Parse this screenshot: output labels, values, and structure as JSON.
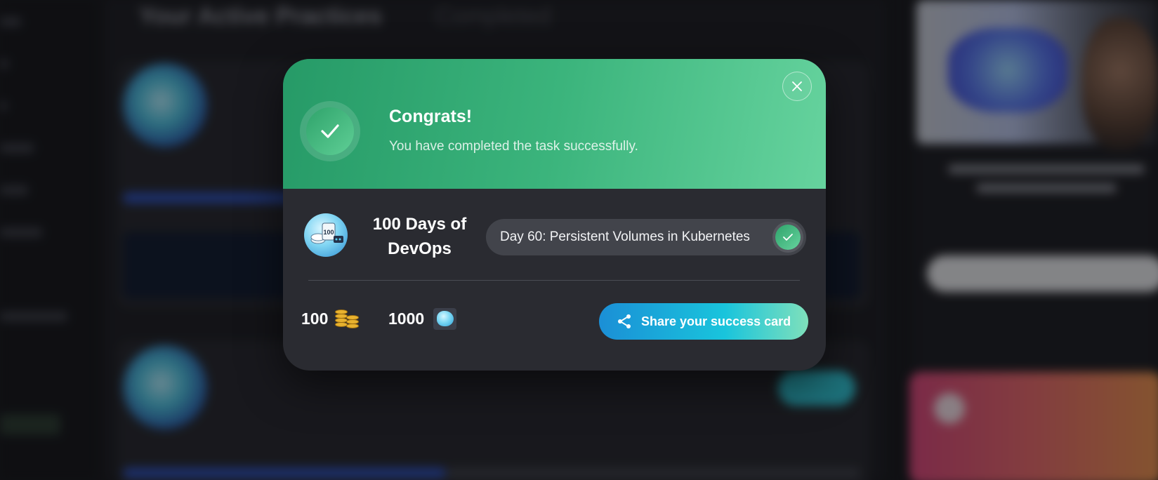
{
  "background": {
    "heading_active": "Your Active Practices",
    "heading_completed": "Completed"
  },
  "modal": {
    "title": "Congrats!",
    "message": "You have completed the task successfully.",
    "close_icon": "close-icon",
    "success_icon": "checkmark-icon",
    "course": {
      "title": "100 Days of DevOps",
      "icon": "devops-course-icon"
    },
    "task": {
      "label": "Day 60: Persistent Volumes in Kubernetes",
      "status_icon": "checkmark-icon"
    },
    "rewards": {
      "coins": "100",
      "coins_icon": "coins-stack-icon",
      "gems": "1000",
      "gems_icon": "gem-icon"
    },
    "share_button": {
      "label": "Share your success card",
      "icon": "share-icon"
    },
    "colors": {
      "header_start": "#269a67",
      "header_end": "#66d39e",
      "body": "#2a2b31",
      "share_start": "#1b8fd6",
      "share_end": "#7fe0bb"
    }
  }
}
